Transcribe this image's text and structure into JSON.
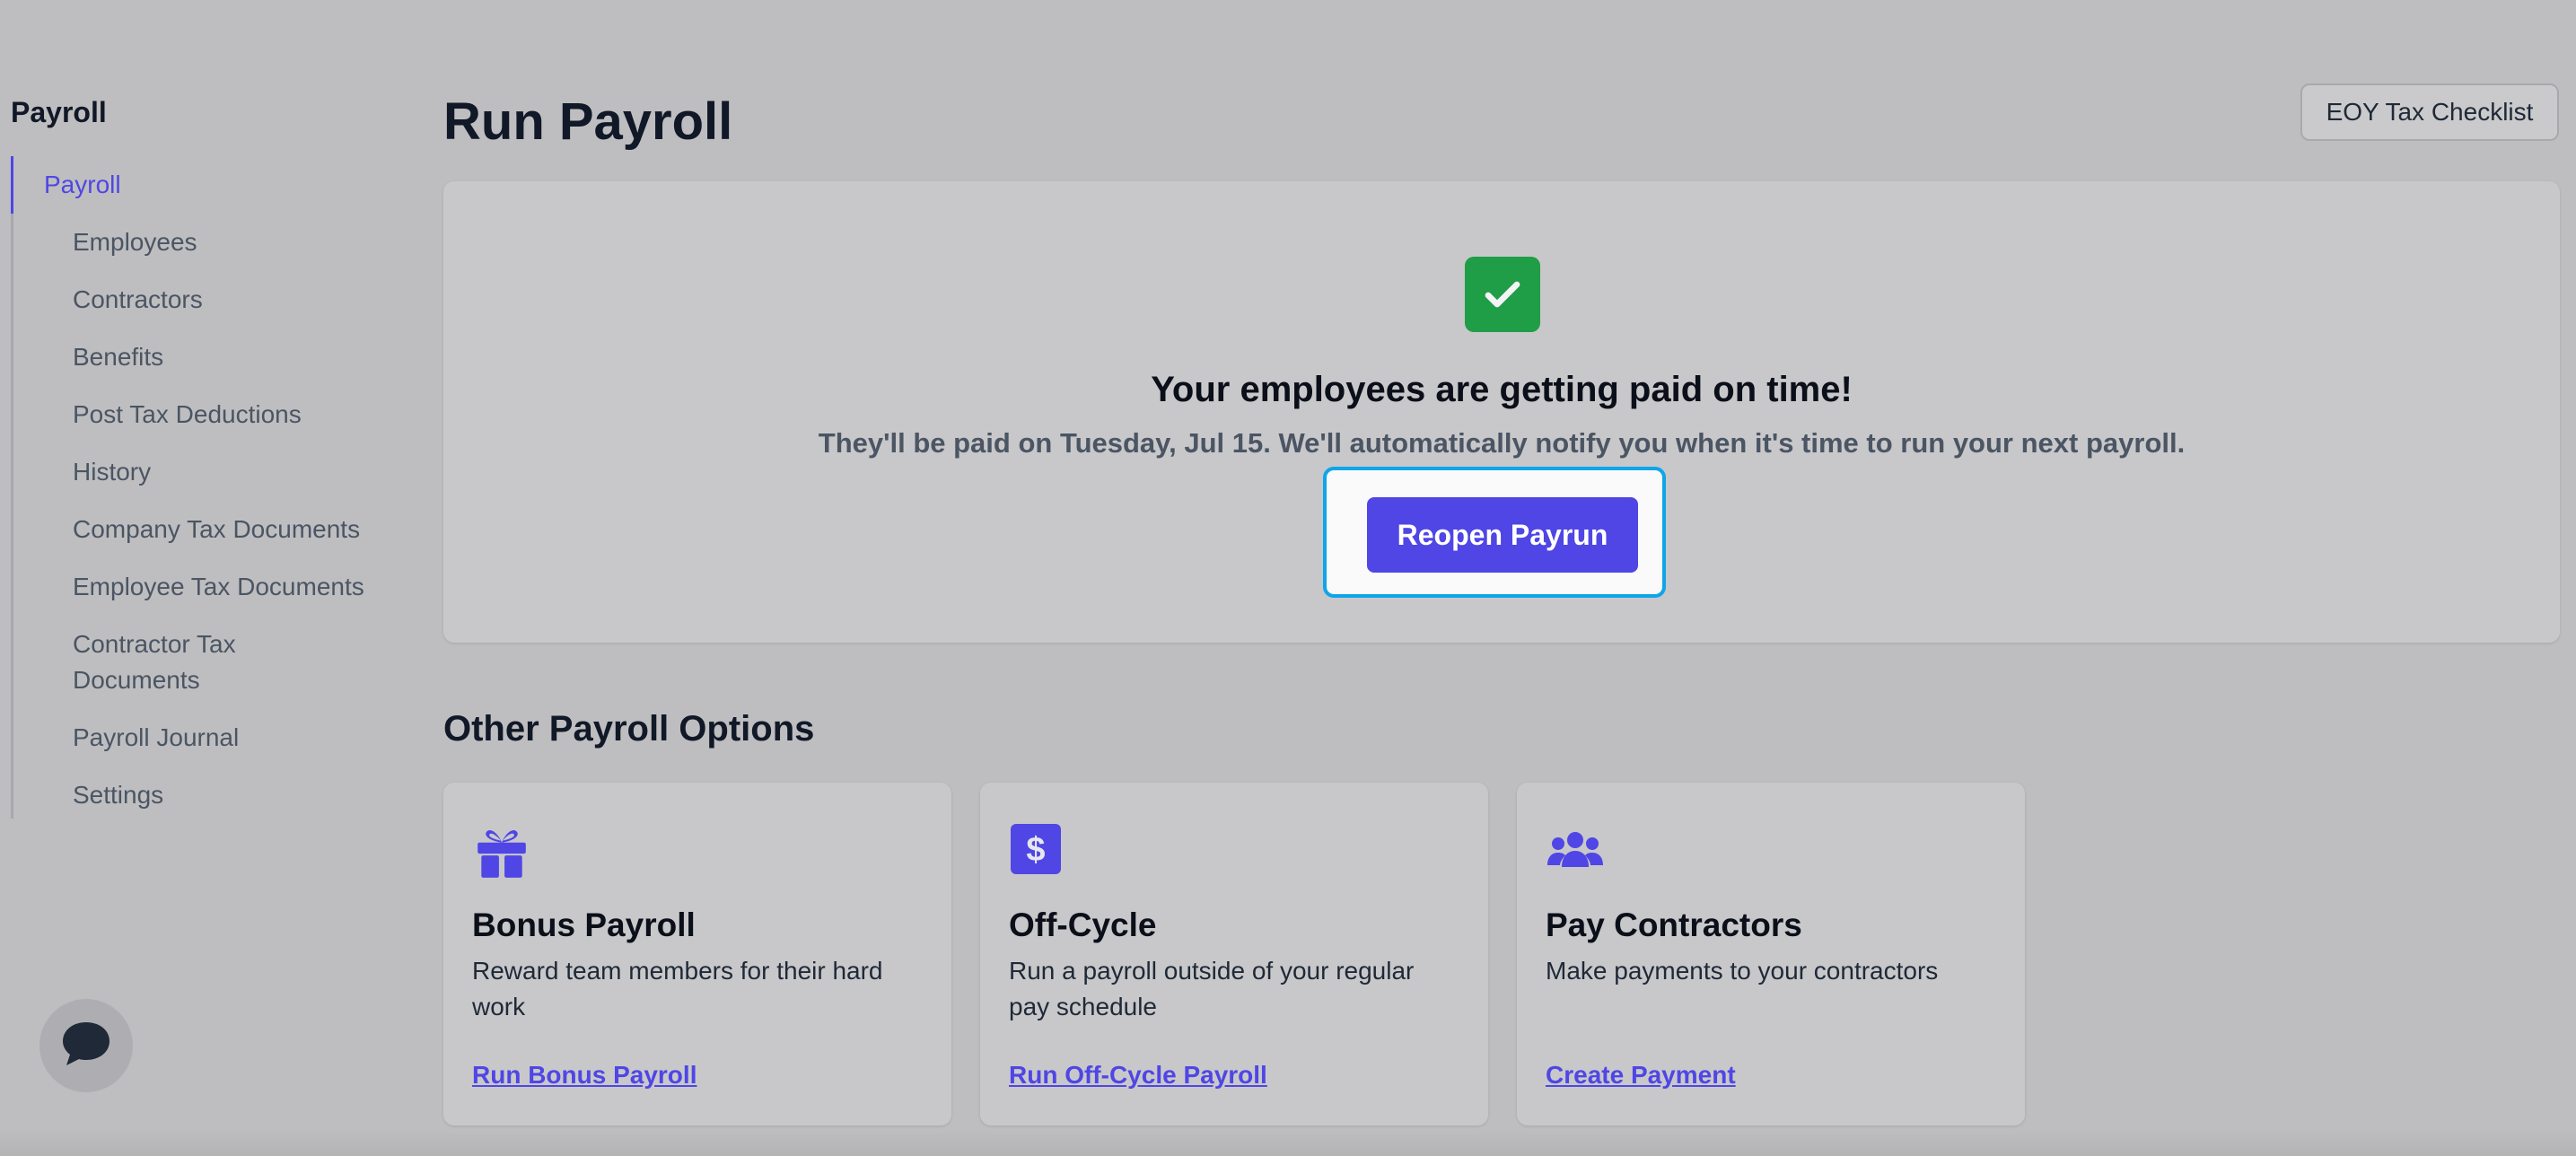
{
  "sidebar": {
    "title": "Payroll",
    "items": [
      {
        "label": "Payroll",
        "active": true
      },
      {
        "label": "Employees"
      },
      {
        "label": "Contractors"
      },
      {
        "label": "Benefits"
      },
      {
        "label": "Post Tax Deductions"
      },
      {
        "label": "History"
      },
      {
        "label": "Company Tax Documents"
      },
      {
        "label": "Employee Tax Documents"
      },
      {
        "label": "Contractor Tax Documents"
      },
      {
        "label": "Payroll Journal"
      },
      {
        "label": "Settings"
      }
    ]
  },
  "header": {
    "title": "Run Payroll",
    "eoy_button": "EOY Tax Checklist"
  },
  "status": {
    "heading": "Your employees are getting paid on time!",
    "subtext": "They'll be paid on Tuesday, Jul 15. We'll automatically notify you when it's time to run your next payroll.",
    "reopen_button": "Reopen Payrun",
    "icon": "check-icon",
    "accent": "#1f9d47"
  },
  "options": {
    "title": "Other Payroll Options",
    "cards": [
      {
        "icon": "gift-icon",
        "title": "Bonus Payroll",
        "description": "Reward team members for their hard work",
        "link": "Run Bonus Payroll"
      },
      {
        "icon": "dollar-icon",
        "title": "Off-Cycle",
        "description": "Run a payroll outside of your regular pay schedule",
        "link": "Run Off-Cycle Payroll"
      },
      {
        "icon": "users-icon",
        "title": "Pay Contractors",
        "description": "Make payments to your contractors",
        "link": "Create Payment"
      }
    ]
  },
  "chat": {
    "icon": "chat-icon"
  },
  "colors": {
    "primary": "#4f46e5",
    "focus": "#0ea5e9",
    "success": "#1f9d47"
  }
}
